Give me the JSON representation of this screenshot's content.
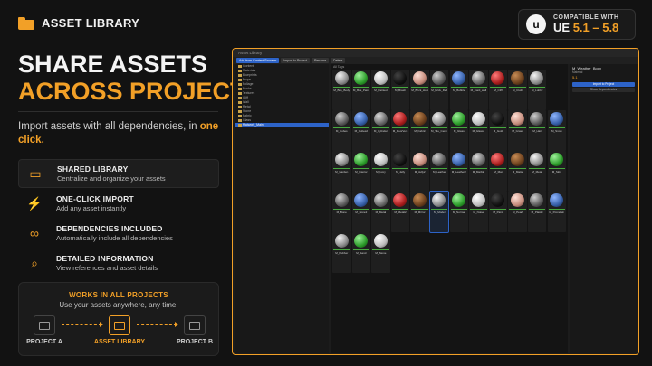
{
  "brand": {
    "title": "ASSET LIBRARY",
    "icon": "folder-icon"
  },
  "compat": {
    "top": "COMPATIBLE WITH",
    "engine": "UE",
    "version": "5.1 – 5.8",
    "logo": "u"
  },
  "headline": {
    "line1": "SHARE ASSETS",
    "line2": "ACROSS PROJECTS"
  },
  "subtitle": {
    "text": "Import assets with all dependencies, in",
    "highlight": "one click."
  },
  "features": [
    {
      "icon": "folder-icon",
      "glyph": "▭",
      "title": "SHARED LIBRARY",
      "desc": "Centralize and organize your assets"
    },
    {
      "icon": "lightning-icon",
      "glyph": "⚡",
      "title": "ONE-CLICK IMPORT",
      "desc": "Add any asset instantly"
    },
    {
      "icon": "link-icon",
      "glyph": "∞",
      "title": "DEPENDENCIES INCLUDED",
      "desc": "Automatically include all dependencies"
    },
    {
      "icon": "search-icon",
      "glyph": "⌕",
      "title": "DETAILED INFORMATION",
      "desc": "View references and asset details"
    }
  ],
  "works": {
    "title": "WORKS IN ALL PROJECTS",
    "sub": "Use your assets anywhere, any time.",
    "nodes": [
      "PROJECT A",
      "ASSET LIBRARY",
      "PROJECT B"
    ]
  },
  "editor": {
    "title": "Asset Library",
    "toolbar": [
      "Add from Content Browser",
      "Import to Project",
      "Rename",
      "Delete"
    ],
    "grid_header": "All Tags",
    "tree": [
      {
        "label": "Content",
        "count": ""
      },
      {
        "label": "Materials",
        "count": ""
      },
      {
        "label": "Blueprints",
        "count": ""
      },
      {
        "label": "Props",
        "count": ""
      },
      {
        "label": "Foliage",
        "count": ""
      },
      {
        "label": "Rocks",
        "count": ""
      },
      {
        "label": "Textures",
        "count": ""
      },
      {
        "label": "Cliff",
        "count": ""
      },
      {
        "label": "Wall",
        "count": ""
      },
      {
        "label": "Metal",
        "count": ""
      },
      {
        "label": "Stone",
        "count": ""
      },
      {
        "label": "Fabric",
        "count": ""
      },
      {
        "label": "Glass",
        "count": ""
      },
      {
        "label": "Matwork_Main",
        "count": ""
      }
    ],
    "details": {
      "name": "M_Weather_Body",
      "type": "Material",
      "version": "5.1",
      "button1": "Import to Project",
      "button2": "Show Dependencies"
    },
    "rows": [
      [
        "M_Bus_Body",
        "M_Bus_Paint",
        "M_Painted",
        "M_Brash",
        "M_Brick_Hordy",
        "M_Brick_Red",
        "M_Bubble",
        "M_Card_wall",
        "M_Cliff",
        "M_Cloth",
        "M_Lobby",
        ""
      ],
      [
        "M_Cubes",
        "M_Cubes2",
        "M_Cylinder",
        "M_DoorVent",
        "M_Fabric",
        "M_Tile_Ceramic",
        "M_Glass",
        "M_Glass2",
        "M_Gold",
        "M_Grass",
        "M_Hair",
        "M_Snow"
      ],
      [
        "M_Garden",
        "M_Interior",
        "M_Ivory",
        "M_Jelly",
        "M_Jelly2",
        "M_Leather",
        "M_Leather2",
        "M_Marble",
        "M_Mat",
        "M_Matte",
        "M_Metal",
        "M_Skin"
      ],
      [
        "M_Bone",
        "M_Bone2",
        "M_Metal",
        "M_Metal2",
        "M_Mirror",
        "M_Model",
        "M_Normal",
        "M_Noise",
        "M_Paint",
        "M_Pearl",
        "M_Plastic",
        "M_Porcelain"
      ],
      [
        "M_Rubber",
        "M_Sand",
        "M_Stone",
        "",
        "",
        "",
        "",
        "",
        "",
        "",
        "",
        ""
      ]
    ]
  }
}
